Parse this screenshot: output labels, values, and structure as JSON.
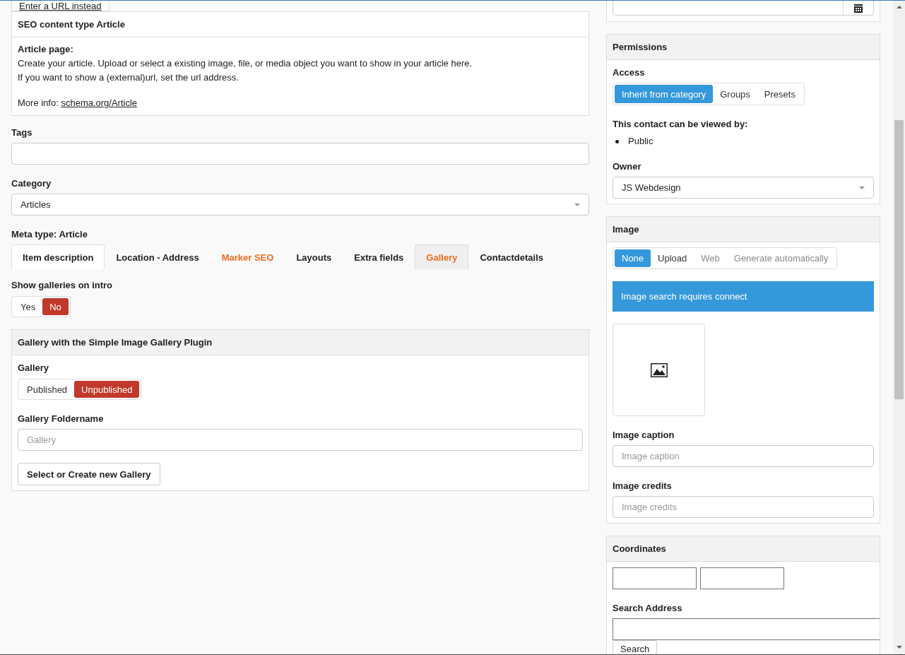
{
  "url_button": {
    "label": "Enter a URL instead"
  },
  "seo_card": {
    "title": "SEO content type Article",
    "heading": "Article page:",
    "lines": [
      "Create your article. Upload or select a existing image, file, or media object you want to show in your article here.",
      "If you want to show a (external)url, set the url address."
    ],
    "more_info": {
      "label": "More info:",
      "link": "schema.org/Article"
    }
  },
  "tags": {
    "label": "Tags"
  },
  "category": {
    "label": "Category",
    "value": "Articles"
  },
  "meta_type": {
    "label": "Meta type: Article"
  },
  "tabs": [
    {
      "label": "Item description",
      "selected": false,
      "focused": true,
      "highlighted": false
    },
    {
      "label": "Location - Address",
      "selected": false,
      "focused": false,
      "highlighted": false
    },
    {
      "label": "Marker SEO",
      "selected": false,
      "focused": false,
      "highlighted": true
    },
    {
      "label": "Layouts",
      "selected": false,
      "focused": false,
      "highlighted": false
    },
    {
      "label": "Extra fields",
      "selected": false,
      "focused": false,
      "highlighted": false
    },
    {
      "label": "Gallery",
      "selected": true,
      "focused": false,
      "highlighted": true
    },
    {
      "label": "Contactdetails",
      "selected": false,
      "focused": false,
      "highlighted": false
    }
  ],
  "intro": {
    "label": "Show galleries on intro",
    "options": [
      {
        "label": "Yes",
        "selected": false
      },
      {
        "label": "No",
        "selected": true
      }
    ]
  },
  "gallery_card": {
    "title": "Gallery with the Simple Image Gallery Plugin",
    "gallery": {
      "label": "Gallery",
      "options": [
        {
          "label": "Published",
          "selected": false
        },
        {
          "label": "Unpublished",
          "selected": true
        }
      ]
    },
    "foldername": {
      "label": "Gallery Foldername",
      "placeholder": "Gallery"
    },
    "button": "Select or Create new Gallery"
  },
  "permissions": {
    "title": "Permissions",
    "access": {
      "label": "Access",
      "options": [
        {
          "label": "Inherit from category",
          "selected": true
        },
        {
          "label": "Groups",
          "selected": false
        },
        {
          "label": "Presets",
          "selected": false
        }
      ]
    },
    "viewers": {
      "label": "This contact can be viewed by:",
      "items": [
        "Public"
      ]
    },
    "owner": {
      "label": "Owner",
      "value": "JS Webdesign"
    }
  },
  "image": {
    "title": "Image",
    "sources": [
      {
        "label": "None",
        "selected": true,
        "disabled": false
      },
      {
        "label": "Upload",
        "selected": false,
        "disabled": false
      },
      {
        "label": "Web",
        "selected": false,
        "disabled": true
      },
      {
        "label": "Generate automatically",
        "selected": false,
        "disabled": true
      }
    ],
    "notice": "Image search requires connect",
    "caption": {
      "label": "Image caption",
      "placeholder": "Image caption"
    },
    "credits": {
      "label": "Image credits",
      "placeholder": "Image credits"
    }
  },
  "coordinates": {
    "title": "Coordinates",
    "search": {
      "label": "Search Address",
      "button": "Search"
    }
  }
}
